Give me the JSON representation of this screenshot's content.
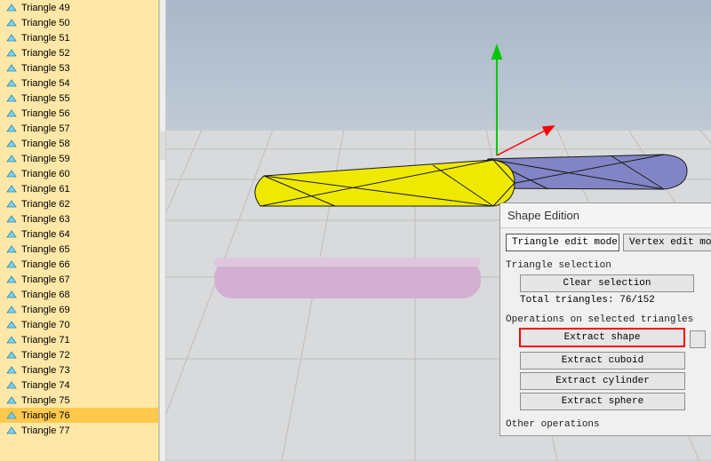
{
  "sidebar": {
    "items": [
      {
        "label": "Triangle 49"
      },
      {
        "label": "Triangle 50"
      },
      {
        "label": "Triangle 51"
      },
      {
        "label": "Triangle 52"
      },
      {
        "label": "Triangle 53"
      },
      {
        "label": "Triangle 54"
      },
      {
        "label": "Triangle 55"
      },
      {
        "label": "Triangle 56"
      },
      {
        "label": "Triangle 57"
      },
      {
        "label": "Triangle 58"
      },
      {
        "label": "Triangle 59"
      },
      {
        "label": "Triangle 60"
      },
      {
        "label": "Triangle 61"
      },
      {
        "label": "Triangle 62"
      },
      {
        "label": "Triangle 63"
      },
      {
        "label": "Triangle 64"
      },
      {
        "label": "Triangle 65"
      },
      {
        "label": "Triangle 66"
      },
      {
        "label": "Triangle 67"
      },
      {
        "label": "Triangle 68"
      },
      {
        "label": "Triangle 69"
      },
      {
        "label": "Triangle 70"
      },
      {
        "label": "Triangle 71"
      },
      {
        "label": "Triangle 72"
      },
      {
        "label": "Triangle 73"
      },
      {
        "label": "Triangle 74"
      },
      {
        "label": "Triangle 75"
      },
      {
        "label": "Triangle 76"
      },
      {
        "label": "Triangle 77"
      }
    ],
    "selected_index": 27
  },
  "panel": {
    "title": "Shape Edition",
    "mode_triangle": "Triangle edit mode",
    "mode_vertex": "Vertex edit mod",
    "section_triangle_selection": "Triangle selection",
    "clear_selection": "Clear selection",
    "total_triangles": "Total triangles: 76/152",
    "section_ops": "Operations on selected triangles",
    "extract_shape": "Extract shape",
    "extract_cuboid": "Extract cuboid",
    "extract_cylinder": "Extract cylinder",
    "extract_sphere": "Extract sphere",
    "other_ops": "Other operations"
  },
  "scene": {
    "axes": {
      "x_color": "#ff0000",
      "y_color": "#00c800"
    },
    "shape_yellow": "#e7e200",
    "shape_blue": "#8285c5",
    "shape_pink": "#d3b0d1"
  }
}
